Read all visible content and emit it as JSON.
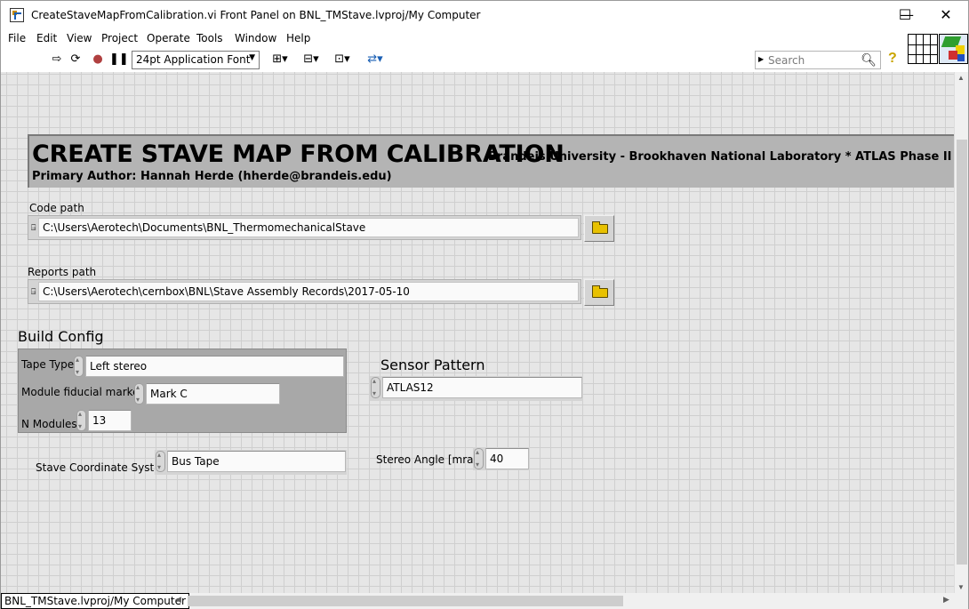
{
  "window": {
    "title": "CreateStaveMapFromCalibration.vi Front Panel on BNL_TMStave.lvproj/My Computer",
    "controls": {
      "minimize": "—",
      "maximize": "☐",
      "close": "✕"
    }
  },
  "menu": [
    "File",
    "Edit",
    "View",
    "Project",
    "Operate",
    "Tools",
    "Window",
    "Help"
  ],
  "toolbar": {
    "font": "24pt Application Font",
    "search_placeholder": "Search",
    "help": "?"
  },
  "header": {
    "title": "CREATE STAVE MAP FROM CALIBRATION",
    "institutions": "Brandeis University - Brookhaven National Laboratory * ATLAS Phase II Inner Tracker",
    "author": "Primary Author: Hannah Herde (hherde@brandeis.edu)"
  },
  "code_path": {
    "label": "Code path",
    "value": "C:\\Users\\Aerotech\\Documents\\BNL_ThermomechanicalStave"
  },
  "reports_path": {
    "label": "Reports path",
    "value": "C:\\Users\\Aerotech\\cernbox\\BNL\\Stave Assembly Records\\2017-05-10"
  },
  "build_config": {
    "title": "Build Config",
    "tape_type": {
      "label": "Tape Type",
      "value": "Left stereo"
    },
    "module_fiducial_marker": {
      "label": "Module fiducial marker",
      "value": "Mark C"
    },
    "n_modules": {
      "label": "N Modules",
      "value": "13"
    }
  },
  "sensor_pattern": {
    "label": "Sensor Pattern",
    "value": "ATLAS12"
  },
  "stave_coordinate_system": {
    "label": "Stave Coordinate System",
    "value": "Bus Tape"
  },
  "stereo_angle": {
    "label": "Stereo Angle [mrad]",
    "value": "40"
  },
  "status": {
    "path": "BNL_TMStave.lvproj/My Computer"
  }
}
